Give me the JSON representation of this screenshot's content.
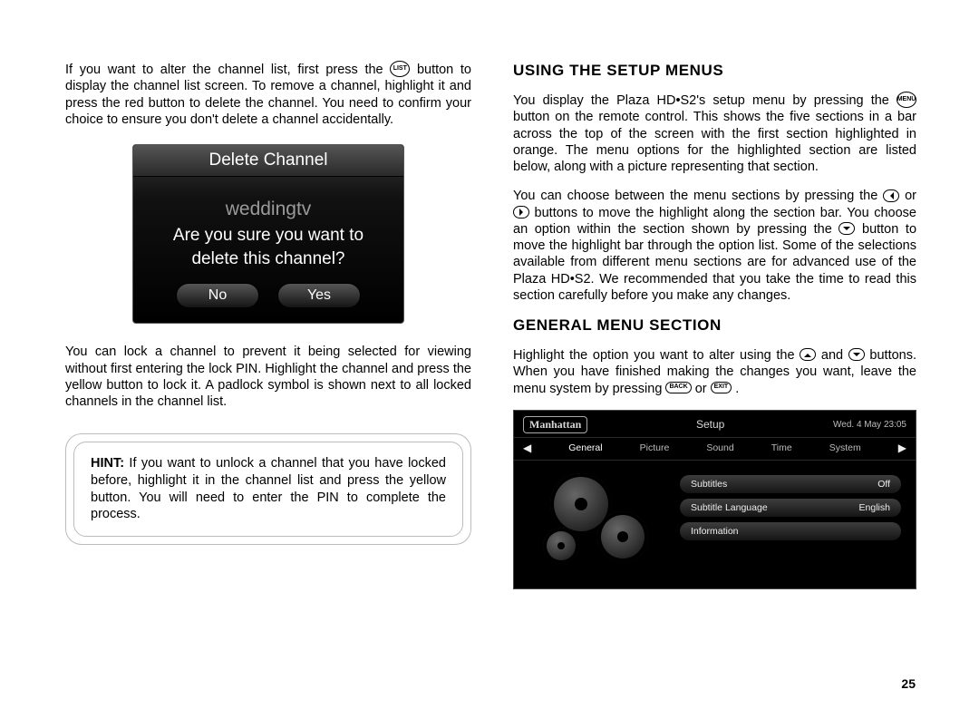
{
  "left": {
    "p1a": "If you want to alter the channel list, first press the ",
    "btn_list": "LIST",
    "p1b": " button to display the channel list screen. To remove a channel, highlight it and press the red button to delete the channel. You need to confirm your choice to ensure you don't delete a channel accidentally.",
    "dialog": {
      "title": "Delete Channel",
      "channel": "weddingtv",
      "question": "Are you sure you want to delete this channel?",
      "no": "No",
      "yes": "Yes"
    },
    "p2": "You can lock a channel to prevent it being selected for viewing without first entering the lock PIN. Highlight the channel and press the yellow button to lock it. A padlock symbol is shown next to all locked channels in the channel list.",
    "hint_label": "HINT:",
    "hint": "  If you want to unlock a channel that you have locked before, highlight it in the channel list and press the yellow button. You will need to enter the PIN to complete the process."
  },
  "right": {
    "h1": "USING THE SETUP MENUS",
    "p1a": "You display the Plaza HD•S2's setup menu by pressing the ",
    "btn_menu": "MENU",
    "p1b": " button on the remote control. This shows the five sections in a bar across the top of the screen with the first section highlighted in orange. The menu options for the highlighted section are listed below, along with a picture representing that section.",
    "p2a": "You can choose between the menu sections by pressing the ",
    "p2_or": " or ",
    "p2b": " buttons to move the highlight along the section bar. You choose an option within the section shown by pressing the ",
    "p2c": " button to move the highlight bar through the option list. Some of the selections available from different menu sections are for advanced use of the Plaza HD•S2. We recommended that you take the time to read this section carefully before you make any changes.",
    "h2": "GENERAL MENU SECTION",
    "p3a": "Highlight the option you want to alter using the ",
    "p3_and": " and ",
    "p3b": " buttons. When you have finished making the changes you want, leave the menu system by pressing ",
    "btn_back": "BACK",
    "p3_or": " or ",
    "btn_exit": "EXIT",
    "p3c": ".",
    "setup": {
      "brand": "Manhattan",
      "title": "Setup",
      "date": "Wed. 4 May  23:05",
      "tabs": [
        "General",
        "Picture",
        "Sound",
        "Time",
        "System"
      ],
      "opts": [
        {
          "k": "Subtitles",
          "v": "Off"
        },
        {
          "k": "Subtitle Language",
          "v": "English"
        },
        {
          "k": "Information",
          "v": ""
        }
      ]
    }
  },
  "pagenum": "25"
}
